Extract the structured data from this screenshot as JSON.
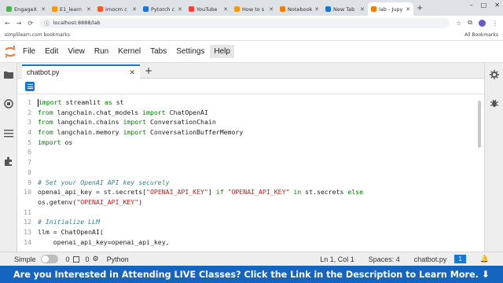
{
  "browser": {
    "tabs": [
      {
        "label": "EngageX",
        "color": "#4caf50",
        "active": false
      },
      {
        "label": "E1_learn",
        "color": "#ff9800",
        "active": false
      },
      {
        "label": "Imocm c",
        "color": "#ff5722",
        "active": false
      },
      {
        "label": "Pytorch c",
        "color": "#1976d2",
        "active": false
      },
      {
        "label": "YouTube",
        "color": "#f44336",
        "active": false
      },
      {
        "label": "How to s",
        "color": "#ff9800",
        "active": false
      },
      {
        "label": "Notebook",
        "color": "#f57c00",
        "active": false
      },
      {
        "label": "New Tab",
        "color": "#1976d2",
        "active": false
      },
      {
        "label": "lab - Jupy",
        "color": "#f57c00",
        "active": true
      }
    ],
    "new_tab_label": "+",
    "window_controls": [
      "–",
      "□",
      "✕"
    ],
    "address": "localhost:8888/lab",
    "bookmark": "simplilearn.com bookmarks",
    "all_bookmarks": "All Bookmarks"
  },
  "menubar": {
    "items": [
      "File",
      "Edit",
      "View",
      "Run",
      "Kernel",
      "Tabs",
      "Settings",
      "Help"
    ],
    "highlighted": "Help"
  },
  "editor": {
    "tab_name": "chatbot.py",
    "close_symbol": "✕",
    "add_tab_symbol": "+",
    "lines": [
      {
        "n": "1",
        "parts": [
          {
            "t": "import",
            "c": "kw"
          },
          {
            "t": " streamlit ",
            "c": "plain"
          },
          {
            "t": "as",
            "c": "kw"
          },
          {
            "t": " st",
            "c": "plain"
          }
        ]
      },
      {
        "n": "2",
        "parts": [
          {
            "t": "from",
            "c": "kw"
          },
          {
            "t": " langchain.chat_models ",
            "c": "plain"
          },
          {
            "t": "import",
            "c": "kw"
          },
          {
            "t": " ChatOpenAI",
            "c": "plain"
          }
        ]
      },
      {
        "n": "3",
        "parts": [
          {
            "t": "from",
            "c": "kw"
          },
          {
            "t": " langchain.chains ",
            "c": "plain"
          },
          {
            "t": "import",
            "c": "kw"
          },
          {
            "t": " ConversationChain",
            "c": "plain"
          }
        ]
      },
      {
        "n": "4",
        "parts": [
          {
            "t": "from",
            "c": "kw"
          },
          {
            "t": " langchain.memory ",
            "c": "plain"
          },
          {
            "t": "import",
            "c": "kw"
          },
          {
            "t": " ConversationBufferMemory",
            "c": "plain"
          }
        ]
      },
      {
        "n": "5",
        "parts": [
          {
            "t": "import",
            "c": "kw"
          },
          {
            "t": " os",
            "c": "plain"
          }
        ]
      },
      {
        "n": "6",
        "parts": []
      },
      {
        "n": "7",
        "parts": []
      },
      {
        "n": "8",
        "parts": []
      },
      {
        "n": "9",
        "parts": [
          {
            "t": "# Set your OpenAI API key securely",
            "c": "cm"
          }
        ]
      },
      {
        "n": "10",
        "parts": [
          {
            "t": "openai_api_key = st.secrets[",
            "c": "plain"
          },
          {
            "t": "\"OPENAI_API_KEY\"",
            "c": "str"
          },
          {
            "t": "] ",
            "c": "plain"
          },
          {
            "t": "if",
            "c": "kw"
          },
          {
            "t": " ",
            "c": "plain"
          },
          {
            "t": "\"OPENAI_API_KEY\"",
            "c": "str"
          },
          {
            "t": " ",
            "c": "plain"
          },
          {
            "t": "in",
            "c": "kw"
          },
          {
            "t": " st.secrets ",
            "c": "plain"
          },
          {
            "t": "else",
            "c": "kw"
          }
        ]
      },
      {
        "n": "",
        "parts": [
          {
            "t": "os.getenv(",
            "c": "plain"
          },
          {
            "t": "\"OPENAI_API_KEY\"",
            "c": "str"
          },
          {
            "t": ")",
            "c": "plain"
          }
        ]
      },
      {
        "n": "11",
        "parts": []
      },
      {
        "n": "12",
        "parts": [
          {
            "t": "# Initialize LLM",
            "c": "cm"
          }
        ]
      },
      {
        "n": "13",
        "parts": [
          {
            "t": "llm = ChatOpenAI(",
            "c": "plain"
          }
        ]
      },
      {
        "n": "14",
        "parts": [
          {
            "t": "    openai_api_key=openai_api_key,",
            "c": "plain"
          }
        ]
      }
    ]
  },
  "statusbar": {
    "mode_label": "Simple",
    "count_a": "0",
    "count_b": "0",
    "language": "Python",
    "position": "Ln 1, Col 1",
    "spaces": "Spaces: 4",
    "filename": "chatbot.py",
    "badge": "1"
  },
  "banner": {
    "text": "Are you Interested in Attending LIVE Classes? Click the Link in the Description to Learn More.",
    "arrow": "⬇"
  }
}
